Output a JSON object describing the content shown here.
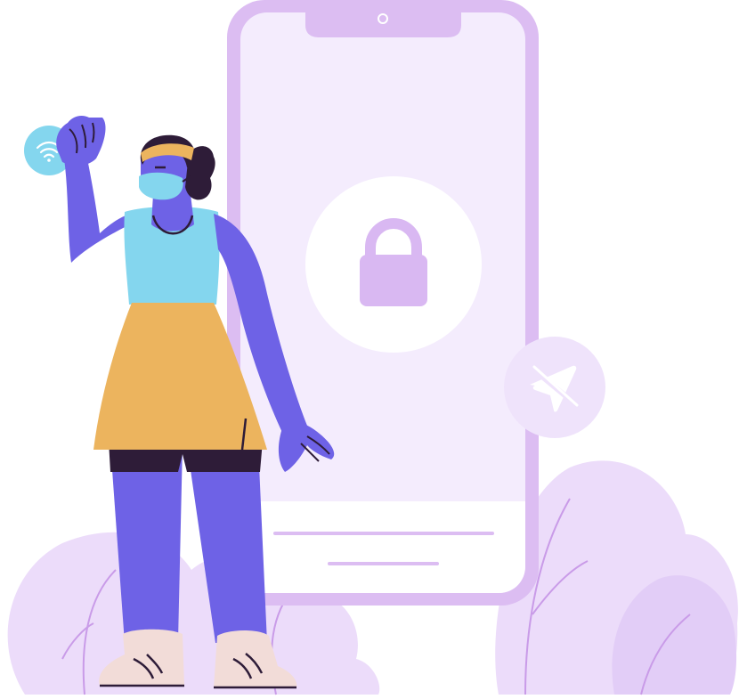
{
  "illustration": {
    "icons": {
      "lock": "lock-icon",
      "wifi": "wifi-icon",
      "airplane_mode_off": "airplane-off-icon"
    },
    "colors": {
      "phone_frame": "#dcbdf2",
      "phone_screen": "#f4ecfd",
      "phone_lock_circle": "#ffffff",
      "lock": "#d9b8f2",
      "foliage": "#ecdcfa",
      "foliage_dark": "#e2cdf7",
      "foliage_line": "#c99be8",
      "wifi_bubble": "#84d6ee",
      "airplane_bubble": "#efe3fb",
      "skin": "#6e62e6",
      "top": "#84d6ee",
      "skirt": "#ecb45e",
      "shorts": "#2e1c38",
      "hair": "#2e1c38",
      "headband": "#ecb45e",
      "mask": "#84d6ee",
      "shoes": "#f2dcd8",
      "outline": "#2e1c38"
    }
  }
}
